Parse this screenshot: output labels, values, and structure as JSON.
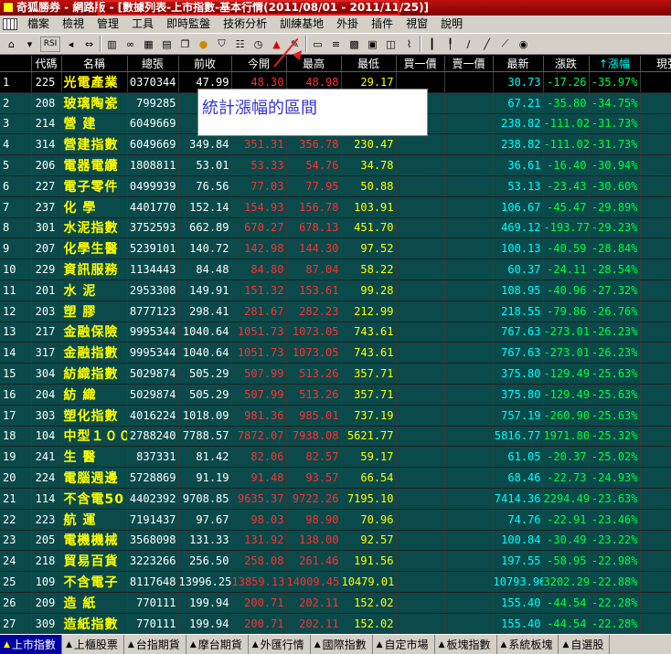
{
  "window": {
    "title": "奇狐勝券 - 網路版 - [數據列表-上市指數-基本行情(2011/08/01 - 2011/11/25)]"
  },
  "menu": [
    "檔案",
    "檢視",
    "管理",
    "工具",
    "即時監盤",
    "技術分析",
    "訓練基地",
    "外掛",
    "插件",
    "視窗",
    "說明"
  ],
  "annotation": {
    "text": "統計漲幅的區間"
  },
  "columns": [
    "",
    "代碼",
    "名稱",
    "總張",
    "前收",
    "今開",
    "最高",
    "最低",
    "買一價",
    "賣一價",
    "最新",
    "漲跌",
    "↑漲幅",
    "現張"
  ],
  "rows": [
    {
      "idx": "1",
      "code": "225",
      "name": "光電產業",
      "vol": "0370344",
      "prev": "47.99",
      "open": "48.30",
      "high": "48.98",
      "low": "29.17",
      "last": "30.73",
      "chg": "-17.26",
      "pct": "-35.97%"
    },
    {
      "idx": "2",
      "code": "208",
      "name": "玻璃陶瓷",
      "vol": "799285",
      "prev": "",
      "open": "",
      "high": "",
      "low": "",
      "last": "67.21",
      "chg": "-35.80",
      "pct": "-34.75%"
    },
    {
      "idx": "3",
      "code": "214",
      "name": "營 建",
      "vol": "6049669",
      "prev": "",
      "open": "",
      "high": "",
      "low": "",
      "last": "238.82",
      "chg": "-111.02",
      "pct": "-31.73%"
    },
    {
      "idx": "4",
      "code": "314",
      "name": "營建指數",
      "vol": "6049669",
      "prev": "349.84",
      "open": "351.31",
      "high": "356.78",
      "low": "230.47",
      "last": "238.82",
      "chg": "-111.02",
      "pct": "-31.73%"
    },
    {
      "idx": "5",
      "code": "206",
      "name": "電器電纜",
      "vol": "1808811",
      "prev": "53.01",
      "open": "53.33",
      "high": "54.76",
      "low": "34.78",
      "last": "36.61",
      "chg": "-16.40",
      "pct": "-30.94%"
    },
    {
      "idx": "6",
      "code": "227",
      "name": "電子零件",
      "vol": "0499939",
      "prev": "76.56",
      "open": "77.03",
      "high": "77.95",
      "low": "50.88",
      "last": "53.13",
      "chg": "-23.43",
      "pct": "-30.60%"
    },
    {
      "idx": "7",
      "code": "237",
      "name": "化 學",
      "vol": "4401770",
      "prev": "152.14",
      "open": "154.93",
      "high": "156.78",
      "low": "103.91",
      "last": "106.67",
      "chg": "-45.47",
      "pct": "-29.89%"
    },
    {
      "idx": "8",
      "code": "301",
      "name": "水泥指數",
      "vol": "3752593",
      "prev": "662.89",
      "open": "670.27",
      "high": "678.13",
      "low": "451.70",
      "last": "469.12",
      "chg": "-193.77",
      "pct": "-29.23%"
    },
    {
      "idx": "9",
      "code": "207",
      "name": "化學生醫",
      "vol": "5239101",
      "prev": "140.72",
      "open": "142.98",
      "high": "144.30",
      "low": "97.52",
      "last": "100.13",
      "chg": "-40.59",
      "pct": "-28.84%"
    },
    {
      "idx": "10",
      "code": "229",
      "name": "資訊服務",
      "vol": "1134443",
      "prev": "84.48",
      "open": "84.80",
      "high": "87.04",
      "low": "58.22",
      "last": "60.37",
      "chg": "-24.11",
      "pct": "-28.54%"
    },
    {
      "idx": "11",
      "code": "201",
      "name": "水 泥",
      "vol": "2953308",
      "prev": "149.91",
      "open": "151.32",
      "high": "153.61",
      "low": "99.28",
      "last": "108.95",
      "chg": "-40.96",
      "pct": "-27.32%"
    },
    {
      "idx": "12",
      "code": "203",
      "name": "塑 膠",
      "vol": "8777123",
      "prev": "298.41",
      "open": "281.67",
      "high": "282.23",
      "low": "212.99",
      "last": "218.55",
      "chg": "-79.86",
      "pct": "-26.76%"
    },
    {
      "idx": "13",
      "code": "217",
      "name": "金融保險",
      "vol": "9995344",
      "prev": "1040.64",
      "open": "1051.73",
      "high": "1073.05",
      "low": "743.61",
      "last": "767.63",
      "chg": "-273.01",
      "pct": "-26.23%"
    },
    {
      "idx": "14",
      "code": "317",
      "name": "金融指數",
      "vol": "9995344",
      "prev": "1040.64",
      "open": "1051.73",
      "high": "1073.05",
      "low": "743.61",
      "last": "767.63",
      "chg": "-273.01",
      "pct": "-26.23%"
    },
    {
      "idx": "15",
      "code": "304",
      "name": "紡織指數",
      "vol": "5029874",
      "prev": "505.29",
      "open": "507.99",
      "high": "513.26",
      "low": "357.71",
      "last": "375.80",
      "chg": "-129.49",
      "pct": "-25.63%"
    },
    {
      "idx": "16",
      "code": "204",
      "name": "紡 織",
      "vol": "5029874",
      "prev": "505.29",
      "open": "507.99",
      "high": "513.26",
      "low": "357.71",
      "last": "375.80",
      "chg": "-129.49",
      "pct": "-25.63%"
    },
    {
      "idx": "17",
      "code": "303",
      "name": "塑化指數",
      "vol": "4016224",
      "prev": "1018.09",
      "open": "981.36",
      "high": "985.01",
      "low": "737.19",
      "last": "757.19",
      "chg": "-260.90",
      "pct": "-25.63%"
    },
    {
      "idx": "18",
      "code": "104",
      "name": "中型１００",
      "vol": "2788240",
      "prev": "7788.57",
      "open": "7872.07",
      "high": "7938.08",
      "low": "5621.77",
      "last": "5816.77",
      "chg": "1971.80",
      "pct": "-25.32%"
    },
    {
      "idx": "19",
      "code": "241",
      "name": "生 醫",
      "vol": "837331",
      "prev": "81.42",
      "open": "82.06",
      "high": "82.57",
      "low": "59.17",
      "last": "61.05",
      "chg": "-20.37",
      "pct": "-25.02%"
    },
    {
      "idx": "20",
      "code": "224",
      "name": "電腦週邊",
      "vol": "5728869",
      "prev": "91.19",
      "open": "91.48",
      "high": "93.57",
      "low": "66.54",
      "last": "68.46",
      "chg": "-22.73",
      "pct": "-24.93%"
    },
    {
      "idx": "21",
      "code": "114",
      "name": "不含電50",
      "vol": "4402392",
      "prev": "9708.85",
      "open": "9635.37",
      "high": "9722.26",
      "low": "7195.10",
      "last": "7414.36",
      "chg": "2294.49",
      "pct": "-23.63%"
    },
    {
      "idx": "22",
      "code": "223",
      "name": "航 運",
      "vol": "7191437",
      "prev": "97.67",
      "open": "98.03",
      "high": "98.90",
      "low": "70.96",
      "last": "74.76",
      "chg": "-22.91",
      "pct": "-23.46%"
    },
    {
      "idx": "23",
      "code": "205",
      "name": "電機機械",
      "vol": "3568098",
      "prev": "131.33",
      "open": "131.92",
      "high": "138.00",
      "low": "92.57",
      "last": "100.84",
      "chg": "-30.49",
      "pct": "-23.22%"
    },
    {
      "idx": "24",
      "code": "218",
      "name": "貿易百貨",
      "vol": "3223266",
      "prev": "256.50",
      "open": "258.08",
      "high": "261.46",
      "low": "191.56",
      "last": "197.55",
      "chg": "-58.95",
      "pct": "-22.98%"
    },
    {
      "idx": "25",
      "code": "109",
      "name": "不含電子",
      "vol": "8117648",
      "prev": "13996.25",
      "open": "13859.13",
      "high": "14009.45",
      "low": "10479.01",
      "last": "10793.96",
      "chg": "3202.29",
      "pct": "-22.88%"
    },
    {
      "idx": "26",
      "code": "209",
      "name": "造 紙",
      "vol": "770111",
      "prev": "199.94",
      "open": "200.71",
      "high": "202.11",
      "low": "152.02",
      "last": "155.40",
      "chg": "-44.54",
      "pct": "-22.28%"
    },
    {
      "idx": "27",
      "code": "309",
      "name": "造紙指數",
      "vol": "770111",
      "prev": "199.94",
      "open": "200.71",
      "high": "202.11",
      "low": "152.02",
      "last": "155.40",
      "chg": "-44.54",
      "pct": "-22.28%"
    },
    {
      "idx": "28",
      "code": "110",
      "name": "不含金電",
      "vol": "8122272",
      "prev": "12487.11",
      "open": "12271.68",
      "high": "12367.90",
      "low": "9497.92",
      "last": "9783.01",
      "chg": "2704.10",
      "pct": "-21.66%"
    }
  ],
  "tabs": [
    "上市指數",
    "上櫃股票",
    "台指期貨",
    "摩台期貨",
    "外匯行情",
    "國際指數",
    "自定市場",
    "板塊指數",
    "系統板塊",
    "自選股"
  ],
  "colors": {
    "up": "#ff3030",
    "down": "#00ff40",
    "name": "#ffff00",
    "row_bg": "#0a4a4a",
    "title_red": "#c01010"
  }
}
